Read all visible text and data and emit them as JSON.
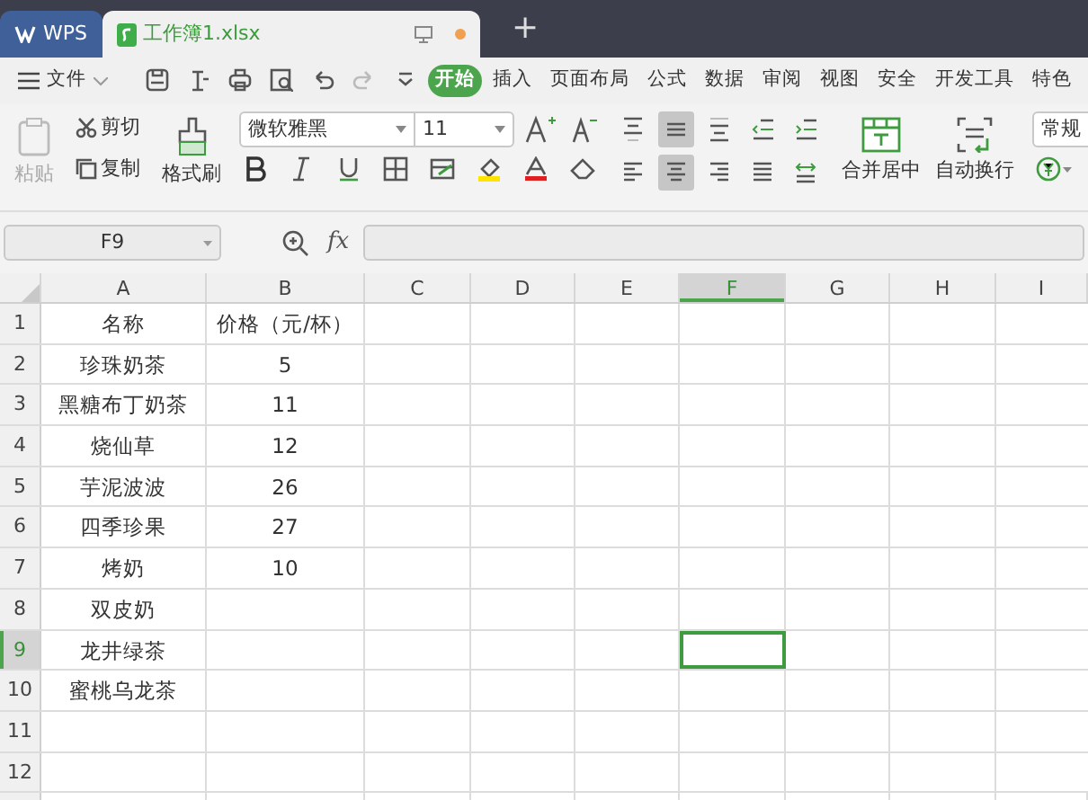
{
  "window_tabs": [
    {
      "label": "WPS",
      "selected": false,
      "unsaved": false
    },
    {
      "label": "工作簿1.xlsx",
      "selected": true,
      "unsaved": true
    }
  ],
  "new_tab": "+",
  "menu": {
    "file": "文件",
    "tabs": [
      {
        "label": "开始",
        "selected": true
      },
      {
        "label": "插入",
        "selected": false
      },
      {
        "label": "页面布局",
        "selected": false
      },
      {
        "label": "公式",
        "selected": false
      },
      {
        "label": "数据",
        "selected": false
      },
      {
        "label": "审阅",
        "selected": false
      },
      {
        "label": "视图",
        "selected": false
      },
      {
        "label": "安全",
        "selected": false
      },
      {
        "label": "开发工具",
        "selected": false
      },
      {
        "label": "特色",
        "selected": false
      }
    ]
  },
  "ribbon": {
    "paste": {
      "label": "粘贴",
      "disabled": true
    },
    "cut": "剪切",
    "copy": "复制",
    "format_painter": "格式刷",
    "font_name": "微软雅黑",
    "font_size": "11",
    "align_top": [
      {
        "selected": false
      },
      {
        "selected": true
      },
      {
        "selected": false
      },
      {
        "selected": false
      },
      {
        "selected": false
      }
    ],
    "align_bottom": [
      {
        "selected": false
      },
      {
        "selected": true
      },
      {
        "selected": false
      },
      {
        "selected": false
      },
      {
        "selected": false
      }
    ],
    "merge": "合并居中",
    "wrap": "自动换行",
    "number_format": "常规"
  },
  "name_box": "F9",
  "formula_label": "fx",
  "sheet": {
    "columns": [
      {
        "label": "A",
        "selected": false
      },
      {
        "label": "B",
        "selected": false
      },
      {
        "label": "C",
        "selected": false
      },
      {
        "label": "D",
        "selected": false
      },
      {
        "label": "E",
        "selected": false
      },
      {
        "label": "F",
        "selected": true
      },
      {
        "label": "G",
        "selected": false
      },
      {
        "label": "H",
        "selected": false
      },
      {
        "label": "I",
        "selected": false
      }
    ],
    "rows": [
      {
        "label": "1",
        "selected": false,
        "cells": [
          "名称",
          "价格（元/杯）"
        ]
      },
      {
        "label": "2",
        "selected": false,
        "cells": [
          "珍珠奶茶",
          "5"
        ]
      },
      {
        "label": "3",
        "selected": false,
        "cells": [
          "黑糖布丁奶茶",
          "11"
        ]
      },
      {
        "label": "4",
        "selected": false,
        "cells": [
          "烧仙草",
          "12"
        ]
      },
      {
        "label": "5",
        "selected": false,
        "cells": [
          "芋泥波波",
          "26"
        ]
      },
      {
        "label": "6",
        "selected": false,
        "cells": [
          "四季珍果",
          "27"
        ]
      },
      {
        "label": "7",
        "selected": false,
        "cells": [
          "烤奶",
          "10"
        ]
      },
      {
        "label": "8",
        "selected": false,
        "cells": [
          "双皮奶",
          ""
        ]
      },
      {
        "label": "9",
        "selected": true,
        "cells": [
          "龙井绿茶",
          ""
        ]
      },
      {
        "label": "10",
        "selected": false,
        "cells": [
          "蜜桃乌龙茶",
          ""
        ]
      },
      {
        "label": "11",
        "selected": false,
        "cells": [
          "",
          ""
        ]
      },
      {
        "label": "12",
        "selected": false,
        "cells": [
          "",
          ""
        ]
      }
    ]
  }
}
